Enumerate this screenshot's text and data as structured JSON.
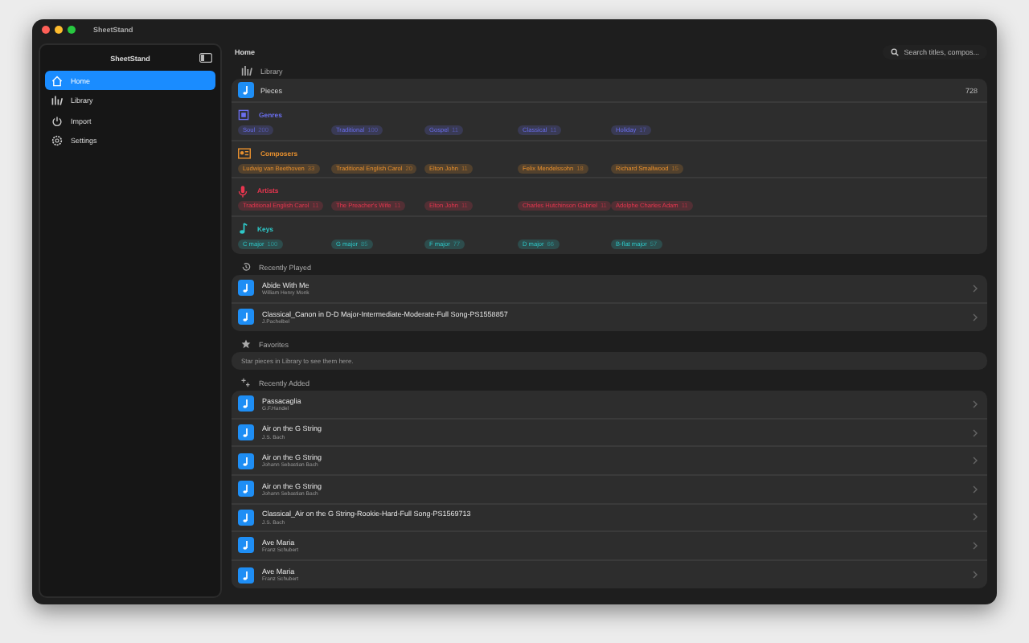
{
  "window": {
    "title": "SheetStand"
  },
  "sidebar": {
    "title": "SheetStand",
    "items": [
      {
        "label": "Home",
        "kind": "home",
        "selected": true
      },
      {
        "label": "Library",
        "kind": "library",
        "selected": false
      },
      {
        "label": "Import",
        "kind": "import",
        "selected": false
      },
      {
        "label": "Settings",
        "kind": "settings",
        "selected": false
      }
    ]
  },
  "main": {
    "title": "Home",
    "search": {
      "placeholder": "Search titles, compos..."
    }
  },
  "library": {
    "title": "Library",
    "pieces": {
      "label": "Pieces",
      "count": "728"
    },
    "categories": [
      {
        "kind": "genres",
        "title": "Genres",
        "color": "#6b6ff0",
        "chips": [
          {
            "label": "Soul",
            "count": "200"
          },
          {
            "label": "Traditional",
            "count": "100"
          },
          {
            "label": "Gospel",
            "count": "11"
          },
          {
            "label": "Classical",
            "count": "11"
          },
          {
            "label": "Holiday",
            "count": "17"
          }
        ]
      },
      {
        "kind": "composers",
        "title": "Composers",
        "color": "#e8902e",
        "chips": [
          {
            "label": "Ludwig van Beethoven",
            "count": "33"
          },
          {
            "label": "Traditional English Carol",
            "count": "20"
          },
          {
            "label": "Elton John",
            "count": "11"
          },
          {
            "label": "Felix Mendelssohn",
            "count": "18"
          },
          {
            "label": "Richard Smallwood",
            "count": "15"
          }
        ]
      },
      {
        "kind": "artists",
        "title": "Artists",
        "color": "#e8364f",
        "chips": [
          {
            "label": "Traditional English Carol",
            "count": "11"
          },
          {
            "label": "The Preacher's Wife",
            "count": "11"
          },
          {
            "label": "Elton John",
            "count": "11"
          },
          {
            "label": "Charles Hutchinson Gabriel",
            "count": "11"
          },
          {
            "label": "Adolphe Charles Adam",
            "count": "11"
          }
        ]
      },
      {
        "kind": "keys",
        "title": "Keys",
        "color": "#2ec8c8",
        "chips": [
          {
            "label": "C major",
            "count": "100"
          },
          {
            "label": "G major",
            "count": "85"
          },
          {
            "label": "F major",
            "count": "77"
          },
          {
            "label": "D major",
            "count": "66"
          },
          {
            "label": "B-flat major",
            "count": "57"
          }
        ]
      }
    ]
  },
  "recently_played": {
    "title": "Recently Played",
    "rows": [
      {
        "title": "Abide With Me",
        "subtitle": "William Henry Monk"
      },
      {
        "title": "Classical_Canon in D-D Major-Intermediate-Moderate-Full Song-PS1558857",
        "subtitle": "J.Pachelbel"
      }
    ]
  },
  "favorites": {
    "title": "Favorites",
    "empty_text": "Star pieces in Library to see them here."
  },
  "recently_added": {
    "title": "Recently Added",
    "rows": [
      {
        "title": "Passacaglia",
        "subtitle": "G.F.Handel"
      },
      {
        "title": "Air on the G String",
        "subtitle": "J.S. Bach"
      },
      {
        "title": "Air on the G String",
        "subtitle": "Johann Sebastian Bach"
      },
      {
        "title": "Air on the G String",
        "subtitle": "Johann Sebastian Bach"
      },
      {
        "title": "Classical_Air on the G String-Rookie-Hard-Full Song-PS1569713",
        "subtitle": "J.S. Bach"
      },
      {
        "title": "Ave Maria",
        "subtitle": "Franz Schubert"
      },
      {
        "title": "Ave Maria",
        "subtitle": "Franz Schubert"
      }
    ]
  }
}
